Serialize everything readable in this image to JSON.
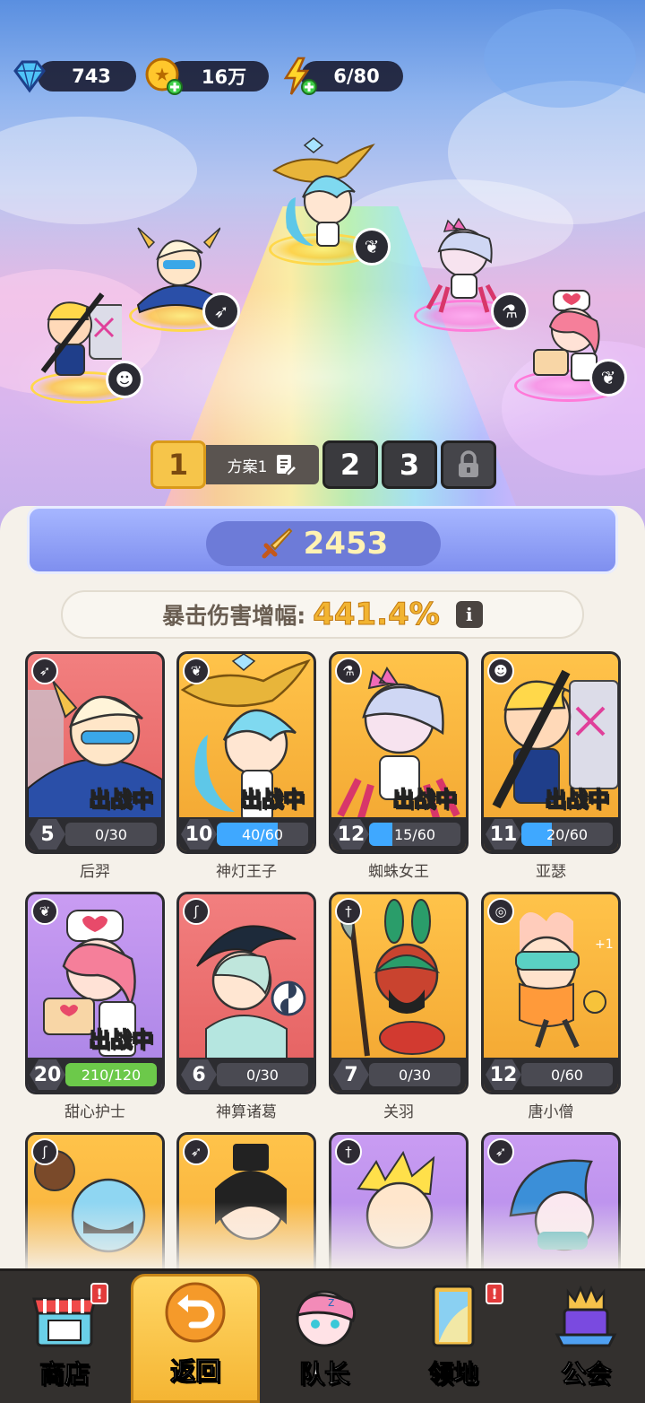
{
  "resources": {
    "gems": "743",
    "gold": "16万",
    "energy": "6/80"
  },
  "plans": {
    "active": "1",
    "active_name": "方案1",
    "tab2": "2",
    "tab3": "3"
  },
  "power": "2453",
  "crit": {
    "label": "暴击伤害增幅:",
    "value": "441.4%"
  },
  "status_label": "出战中",
  "cards": [
    {
      "name": "后羿",
      "level": "5",
      "progress": "0/30",
      "fill": 0.0,
      "in_battle": true
    },
    {
      "name": "神灯王子",
      "level": "10",
      "progress": "40/60",
      "fill": 0.667,
      "in_battle": true
    },
    {
      "name": "蜘蛛女王",
      "level": "12",
      "progress": "15/60",
      "fill": 0.25,
      "in_battle": true
    },
    {
      "name": "亚瑟",
      "level": "11",
      "progress": "20/60",
      "fill": 0.333,
      "in_battle": true
    },
    {
      "name": "甜心护士",
      "level": "20",
      "progress": "210/120",
      "fill": 1.0,
      "in_battle": true
    },
    {
      "name": "神算诸葛",
      "level": "6",
      "progress": "0/30",
      "fill": 0.0,
      "in_battle": false
    },
    {
      "name": "关羽",
      "level": "7",
      "progress": "0/30",
      "fill": 0.0,
      "in_battle": false
    },
    {
      "name": "唐小僧",
      "level": "12",
      "progress": "0/60",
      "fill": 0.0,
      "in_battle": false
    }
  ],
  "nav": {
    "shop": "商店",
    "back": "返回",
    "captain": "队长",
    "territory": "领地",
    "guild": "公会",
    "alert": "!"
  }
}
